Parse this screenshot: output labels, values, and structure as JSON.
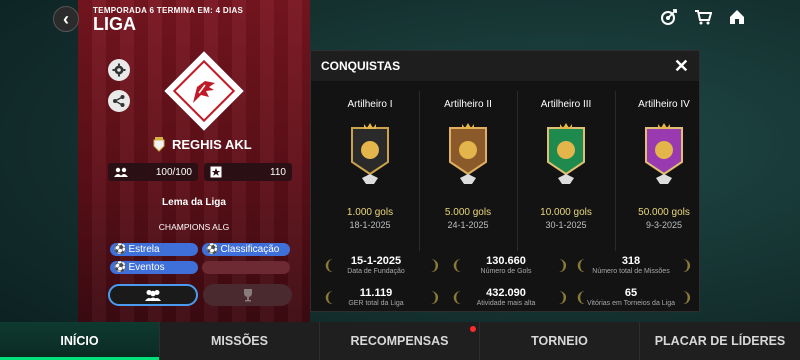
{
  "header": {
    "season_text": "TEMPORADA 6 TERMINA EM: 4 DIAS",
    "title": "LIGA",
    "icons": [
      "target-icon",
      "cart-icon",
      "home-icon"
    ]
  },
  "club": {
    "name": "REGHIS AKL",
    "members": "100/100",
    "rank": "110",
    "motto_title": "Lema da Liga",
    "motto": "CHAMPIONS ALG",
    "tags": [
      "Estrela",
      "Classificação",
      "Eventos"
    ]
  },
  "panel": {
    "title": "CONQUISTAS",
    "achievements": [
      {
        "name": "Artilheiro I",
        "value": "1.000 gols",
        "date": "18-1-2025",
        "color": "#2a2a2a"
      },
      {
        "name": "Artilheiro II",
        "value": "5.000 gols",
        "date": "24-1-2025",
        "color": "#8a5a2a"
      },
      {
        "name": "Artilheiro III",
        "value": "10.000 gols",
        "date": "30-1-2025",
        "color": "#1e8a4e"
      },
      {
        "name": "Artilheiro IV",
        "value": "50.000 gols",
        "date": "9-3-2025",
        "color": "#9a3ab0"
      }
    ],
    "stats": [
      {
        "value": "15-1-2025",
        "label": "Data de Fundação"
      },
      {
        "value": "130.660",
        "label": "Número de Gols"
      },
      {
        "value": "318",
        "label": "Número total de Missões"
      },
      {
        "value": "11.119",
        "label": "GER total da Liga"
      },
      {
        "value": "432.090",
        "label": "Atividade mais alta"
      },
      {
        "value": "65",
        "label": "Vitórias em Torneios da Liga"
      }
    ]
  },
  "nav": {
    "items": [
      "INÍCIO",
      "MISSÕES",
      "RECOMPENSAS",
      "TORNEIO",
      "PLACAR DE LÍDERES"
    ],
    "active": "INÍCIO"
  },
  "colors": {
    "accent_green": "#00e37a",
    "banner_red": "#7a1620",
    "pill_blue": "#3f6fd8",
    "gold_text": "#e9d77a"
  }
}
